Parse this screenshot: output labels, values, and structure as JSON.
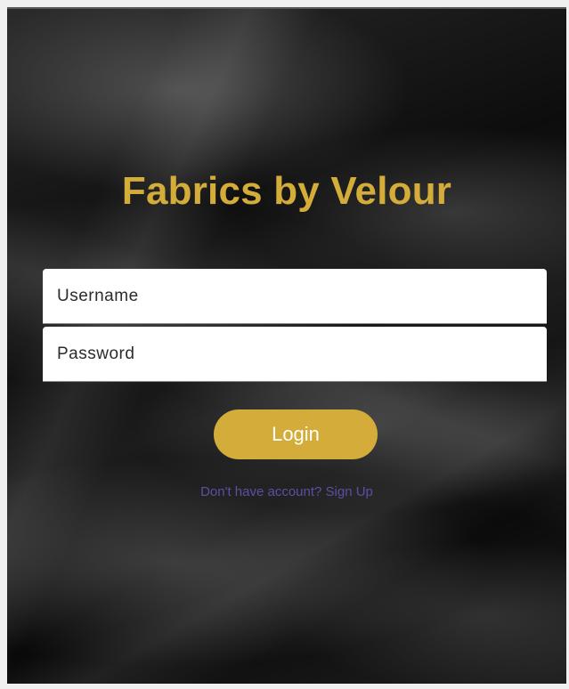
{
  "app": {
    "title": "Fabrics by Velour"
  },
  "form": {
    "username_placeholder": "Username",
    "username_value": "",
    "password_placeholder": "Password",
    "password_value": "",
    "login_label": "Login",
    "signup_text": "Don't have account? Sign Up"
  },
  "colors": {
    "accent": "#d4ac3a",
    "link": "#5b4fa6",
    "background": "#0d0d0d"
  }
}
